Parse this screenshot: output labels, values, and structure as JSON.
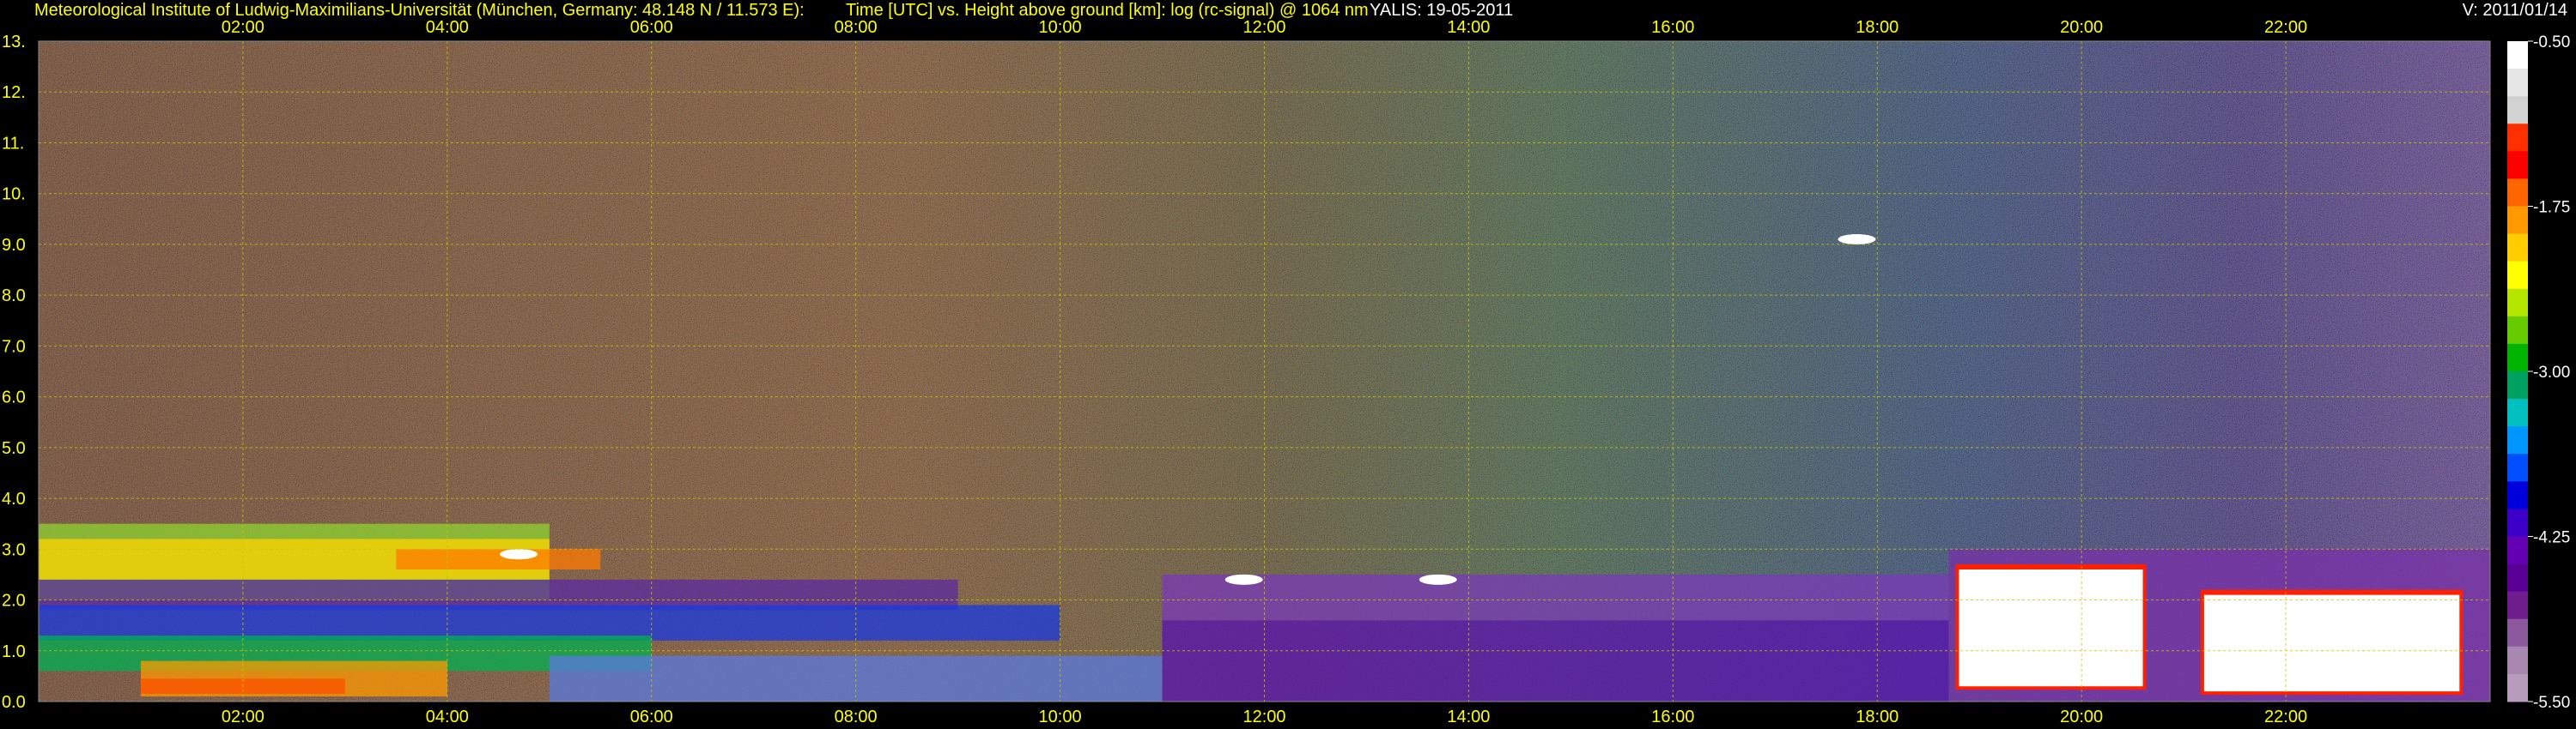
{
  "header": {
    "institute": "Meteorological Institute of Ludwig-Maximilians-Universität (München, Germany: 48.148 N / 11.573 E):",
    "plot_desc": "Time [UTC] vs. Height above ground [km]: log (rc-signal) @ 1064 nm",
    "instrument_date": "YALIS: 19-05-2011",
    "version": "V: 2011/01/14"
  },
  "colors": {
    "background": "#000000",
    "header_text": "#ffff00",
    "tick_text": "#ffff00",
    "version_text": "#ffffff",
    "grid": "#c8c800"
  },
  "chart_data": {
    "type": "heatmap",
    "title": "Time [UTC] vs. Height above ground [km]: log (rc-signal) @ 1064 nm",
    "x_axis": {
      "unit": "UTC hours",
      "range": [
        0.0,
        24.0
      ],
      "ticks": [
        2,
        4,
        6,
        8,
        10,
        12,
        14,
        16,
        18,
        20,
        22
      ],
      "tick_labels": [
        "02:00",
        "04:00",
        "06:00",
        "08:00",
        "10:00",
        "12:00",
        "14:00",
        "16:00",
        "18:00",
        "20:00",
        "22:00"
      ]
    },
    "y_axis": {
      "unit": "km",
      "range": [
        0.0,
        13.0
      ],
      "ticks": [
        0,
        1,
        2,
        3,
        4,
        5,
        6,
        7,
        8,
        9,
        10,
        11,
        12,
        13
      ],
      "tick_labels": [
        "0.0",
        "1.0",
        "2.0",
        "3.0",
        "4.0",
        "5.0",
        "6.0",
        "7.0",
        "8.0",
        "9.0",
        "10.",
        "11.",
        "12.",
        "13."
      ]
    },
    "grid": true,
    "colorbar": {
      "range": [
        -5.5,
        -0.5
      ],
      "ticks": [
        -0.5,
        -1.75,
        -3.0,
        -4.25,
        -5.5
      ],
      "tick_labels": [
        "-0.50",
        "-1.75",
        "-3.00",
        "-4.25",
        "-5.50"
      ],
      "colors": [
        "#ffffff",
        "#e6e6e6",
        "#d2d2d2",
        "#ff3000",
        "#ff0000",
        "#ff6600",
        "#ff9900",
        "#ffcc00",
        "#ffff00",
        "#b4e600",
        "#66cc00",
        "#00b400",
        "#00a060",
        "#00c0c0",
        "#0096ff",
        "#0050ff",
        "#0000dc",
        "#3c00c8",
        "#6400b4",
        "#5a0096",
        "#6e1e8c",
        "#8c5a9c",
        "#a888b0",
        "#b89cbc"
      ]
    },
    "cloud_features": [
      {
        "t": 4.7,
        "h": 2.9,
        "desc_color": "white"
      },
      {
        "t": 11.8,
        "h": 2.4,
        "desc_color": "white"
      },
      {
        "t": 13.7,
        "h": 2.4,
        "desc_color": "white"
      },
      {
        "t": 17.8,
        "h": 9.1,
        "desc_color": "white"
      },
      {
        "t": 19.5,
        "h": 1.5,
        "desc_color": "white"
      },
      {
        "t": 21.8,
        "h": 1.0,
        "desc_color": "white"
      }
    ]
  }
}
